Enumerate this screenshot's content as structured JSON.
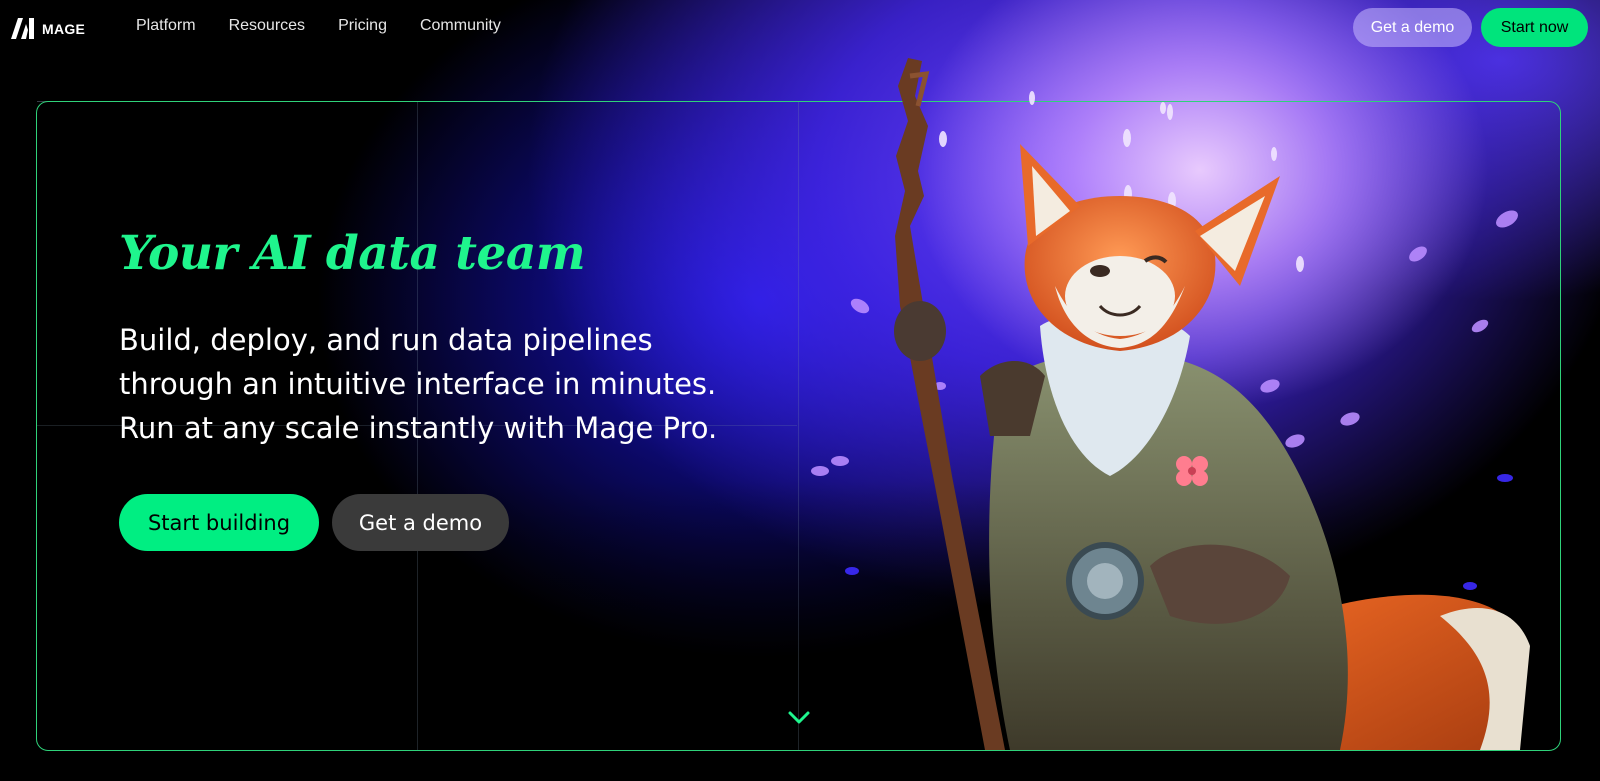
{
  "brand": {
    "name": "MAGE",
    "accent": "#00ee82"
  },
  "nav": {
    "items": [
      "Platform",
      "Resources",
      "Pricing",
      "Community"
    ]
  },
  "header_buttons": {
    "demo": "Get a demo",
    "start": "Start now"
  },
  "hero": {
    "title": "Your AI data team",
    "subtitle": "Build, deploy, and run data pipelines through an intuitive interface in minutes. Run at any scale instantly with Mage Pro.",
    "primary_cta": "Start building",
    "secondary_cta": "Get a demo",
    "scroll_icon": "chevron-down-icon"
  },
  "illustration": {
    "subject": "fox-wizard-illustration"
  }
}
